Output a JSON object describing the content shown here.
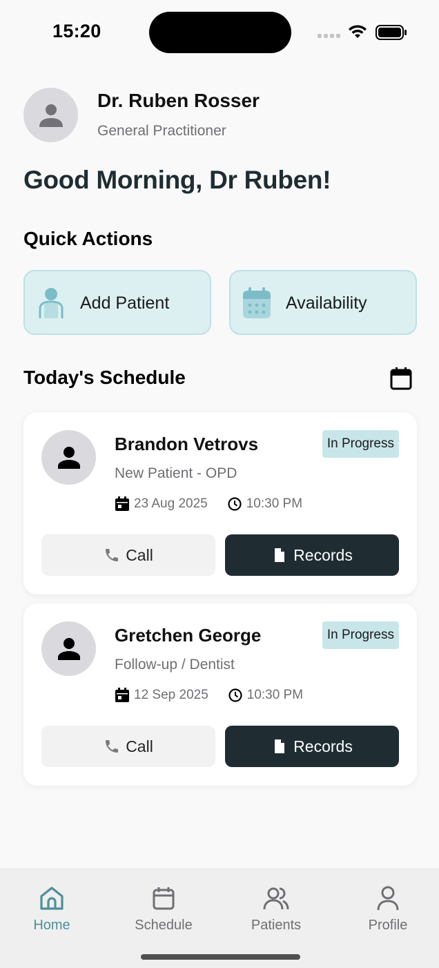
{
  "status_bar": {
    "time": "15:20"
  },
  "header": {
    "doctor_name": "Dr. Ruben Rosser",
    "doctor_role": "General Practitioner",
    "greeting": "Good Morning, Dr Ruben!"
  },
  "quick_actions": {
    "title": "Quick Actions",
    "items": [
      {
        "label": "Add Patient",
        "icon": "person-icon"
      },
      {
        "label": "Availability",
        "icon": "calendar-grid-icon"
      }
    ]
  },
  "schedule": {
    "title": "Today's Schedule",
    "appointments": [
      {
        "name": "Brandon Vetrovs",
        "type": "New Patient - OPD",
        "status": "In Progress",
        "date": "23 Aug 2025",
        "time": "10:30 PM",
        "call_label": "Call",
        "records_label": "Records"
      },
      {
        "name": "Gretchen George",
        "type": "Follow-up / Dentist",
        "status": "In Progress",
        "date": "12 Sep 2025",
        "time": "10:30 PM",
        "call_label": "Call",
        "records_label": "Records"
      }
    ]
  },
  "tab_bar": {
    "tabs": [
      {
        "label": "Home",
        "icon": "home-icon",
        "active": true
      },
      {
        "label": "Schedule",
        "icon": "calendar-icon",
        "active": false
      },
      {
        "label": "Patients",
        "icon": "users-icon",
        "active": false
      },
      {
        "label": "Profile",
        "icon": "user-icon",
        "active": false
      }
    ]
  },
  "colors": {
    "accent": "#4e8f9b",
    "primary_dark": "#1f2d33",
    "quick_action_bg": "#dcf0f2",
    "badge_bg": "#c8e6e9"
  }
}
